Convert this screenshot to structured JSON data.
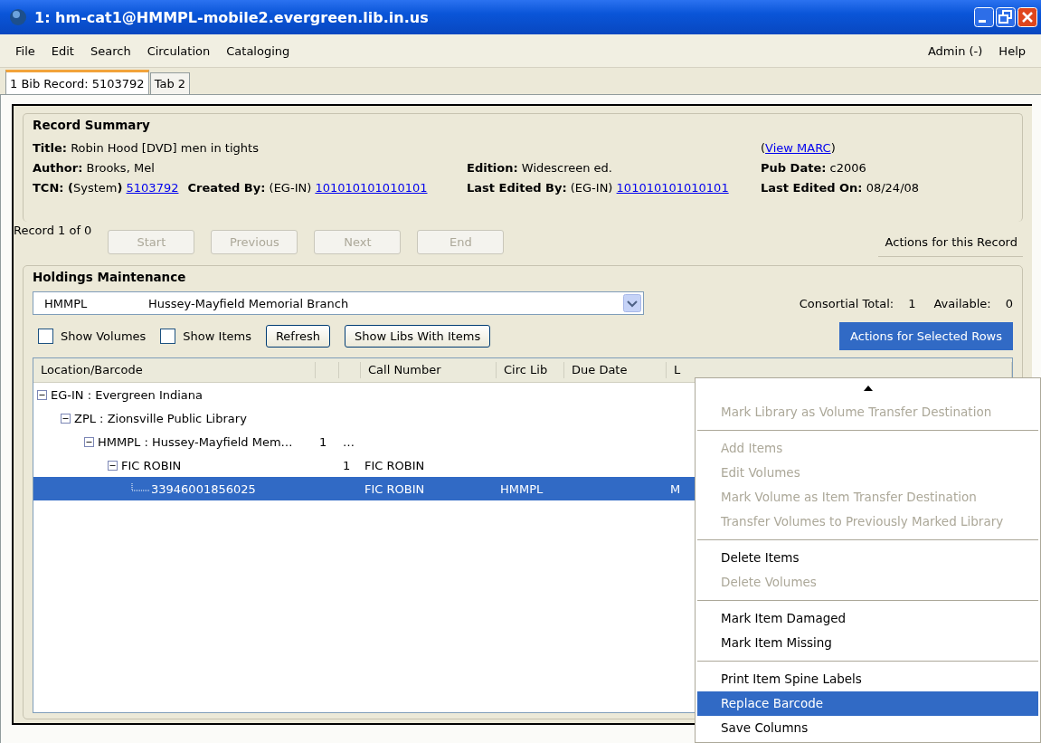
{
  "window": {
    "title": "1: hm-cat1@HMMPL-mobile2.evergreen.lib.in.us"
  },
  "menu_bar": {
    "left": [
      "File",
      "Edit",
      "Search",
      "Circulation",
      "Cataloging"
    ],
    "right": [
      "Admin (-)",
      "Help"
    ]
  },
  "tabs": [
    {
      "label": "1 Bib Record: 5103792",
      "selected": true
    },
    {
      "label": "Tab 2",
      "selected": false
    }
  ],
  "record_summary": {
    "title": "Record Summary",
    "rows": [
      {
        "left": [
          {
            "text": "**Title:** Robin Hood [DVD] men in tights"
          }
        ],
        "right": [
          {
            "text": "(",
            "link": "View MARC",
            "after": ")"
          }
        ]
      },
      {
        "left": [
          {
            "text": "**Author:** Brooks, Mel"
          }
        ],
        "middle": [
          {
            "text": "**Edition:** Widescreen ed."
          }
        ],
        "right": [
          {
            "text": "**Pub Date:** c2006"
          }
        ]
      },
      {
        "left": [
          {
            "text": "**TCN: (**System**)**",
            "link": "5103792"
          },
          {
            "text": "**Created By:** (EG-IN)",
            "link": "101010101010101"
          }
        ],
        "middle": [
          {
            "text": "**Last Edited By:** (EG-IN)",
            "link": "101010101010101"
          }
        ],
        "right": [
          {
            "text": "**Last Edited On:** 08/24/08"
          }
        ]
      }
    ]
  },
  "navigation": {
    "position": "Record 1 of 0",
    "buttons": [
      {
        "label": "Start",
        "disabled": true
      },
      {
        "label": "Previous",
        "disabled": true
      },
      {
        "label": "Next",
        "disabled": true
      },
      {
        "label": "End",
        "disabled": true
      }
    ],
    "actions_button": "Actions for this Record"
  },
  "holdings": {
    "title": "Holdings Maintenance",
    "library": {
      "code": "HMMPL",
      "name": "Hussey-Mayfield Memorial Branch"
    },
    "totals": [
      {
        "label": "Consortial Total:",
        "value": "1"
      },
      {
        "label": "Available:",
        "value": "0"
      }
    ],
    "checkboxes": [
      {
        "label": "Show Volumes",
        "checked": false
      },
      {
        "label": "Show Items",
        "checked": false
      }
    ],
    "buttons": [
      "Refresh",
      "Show Libs With Items"
    ],
    "actions_button": {
      "label": "Actions for Selected Rows",
      "open": true
    },
    "columns": [
      "Location/Barcode",
      "Call Number",
      "Circ Lib",
      "Due Date",
      "L"
    ],
    "tree": [
      {
        "location": "EG-IN : Evergreen Indiana",
        "expanded": true,
        "selected": false,
        "children": [
          {
            "location": "ZPL : Zionsville Public Library",
            "expanded": true,
            "selected": false,
            "children": [
              {
                "location": "HMMPL : Hussey-Mayfield Mem…",
                "column_2": "1",
                "column_3": "…",
                "expanded": true,
                "selected": false,
                "children": [
                  {
                    "location": "FIC ROBIN",
                    "column_3": "1",
                    "call_number": "FIC ROBIN",
                    "expanded": true,
                    "selected": false,
                    "children": [
                      {
                        "location": "33946001856025",
                        "call_number": "FIC ROBIN",
                        "circ_lib": "HMMPL",
                        "column_7": "M",
                        "selected": true
                      }
                    ]
                  }
                ]
              }
            ]
          }
        ]
      }
    ]
  },
  "context_menu": {
    "groups": [
      [
        {
          "label": "Mark Library as Volume Transfer Destination",
          "disabled": true,
          "selected": false
        }
      ],
      [
        {
          "label": "Add Items",
          "disabled": true,
          "selected": false
        },
        {
          "label": "Edit Volumes",
          "disabled": true,
          "selected": false
        },
        {
          "label": "Mark Volume as Item Transfer Destination",
          "disabled": true,
          "selected": false
        },
        {
          "label": "Transfer Volumes to Previously Marked Library",
          "disabled": true,
          "selected": false
        }
      ],
      [
        {
          "label": "Delete Items",
          "disabled": false,
          "selected": false
        },
        {
          "label": "Delete Volumes",
          "disabled": true,
          "selected": false
        }
      ],
      [
        {
          "label": "Mark Item Damaged",
          "disabled": false,
          "selected": false
        },
        {
          "label": "Mark Item Missing",
          "disabled": false,
          "selected": false
        }
      ],
      [
        {
          "label": "Print Item Spine Labels",
          "disabled": false,
          "selected": false
        },
        {
          "label": "Replace Barcode",
          "disabled": false,
          "selected": true
        },
        {
          "label": "Save Columns",
          "disabled": false,
          "selected": false
        }
      ]
    ]
  }
}
